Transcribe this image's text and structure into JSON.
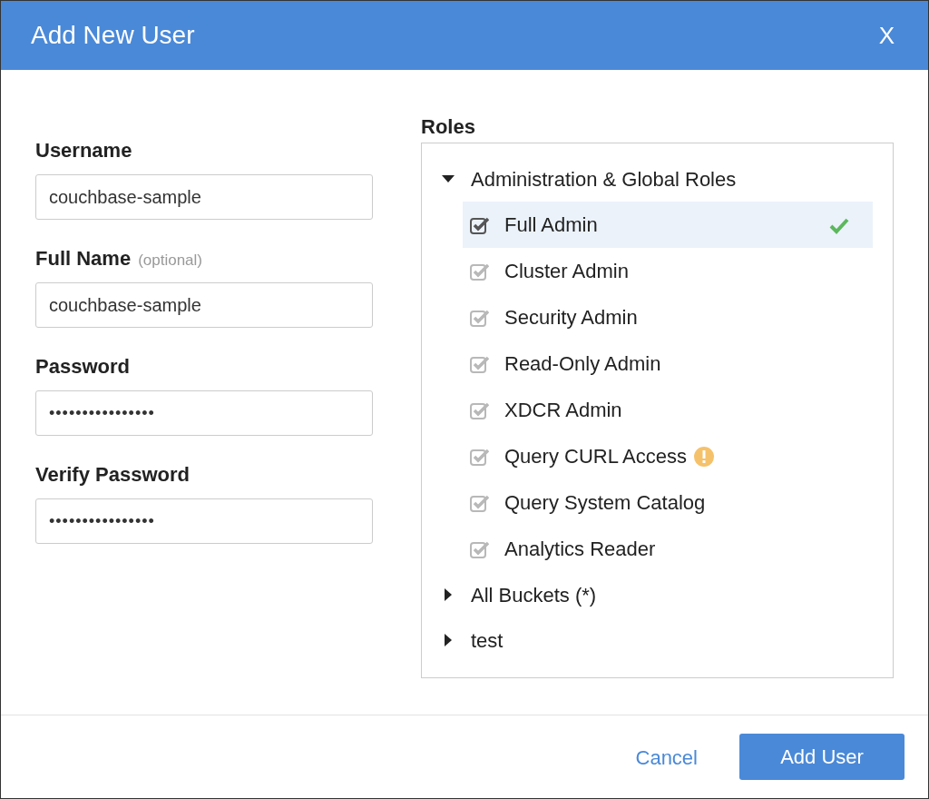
{
  "dialog": {
    "title": "Add New User",
    "close": "X"
  },
  "fields": [
    {
      "label": "Username",
      "kind": "text",
      "value": "couchbase-sample"
    },
    {
      "label": "Full Name",
      "hint": "(optional)",
      "kind": "text",
      "value": "couchbase-sample"
    },
    {
      "label": "Password",
      "kind": "password",
      "value": "••••••••••••••••"
    },
    {
      "label": "Verify Password",
      "kind": "password",
      "value": "••••••••••••••••"
    }
  ],
  "roles": {
    "title": "Roles",
    "groups": [
      {
        "label": "Administration & Global Roles",
        "expanded": true,
        "children": [
          {
            "label": "Full Admin",
            "checked": true,
            "disabled": false,
            "selected": true,
            "warning": false
          },
          {
            "label": "Cluster Admin",
            "checked": true,
            "disabled": true,
            "selected": false,
            "warning": false
          },
          {
            "label": "Security Admin",
            "checked": true,
            "disabled": true,
            "selected": false,
            "warning": false
          },
          {
            "label": "Read-Only Admin",
            "checked": true,
            "disabled": true,
            "selected": false,
            "warning": false
          },
          {
            "label": "XDCR Admin",
            "checked": true,
            "disabled": true,
            "selected": false,
            "warning": false
          },
          {
            "label": "Query CURL Access",
            "checked": true,
            "disabled": true,
            "selected": false,
            "warning": true
          },
          {
            "label": "Query System Catalog",
            "checked": true,
            "disabled": true,
            "selected": false,
            "warning": false
          },
          {
            "label": "Analytics Reader",
            "checked": true,
            "disabled": true,
            "selected": false,
            "warning": false
          }
        ]
      },
      {
        "label": "All Buckets (*)",
        "expanded": false
      },
      {
        "label": "test",
        "expanded": false
      }
    ]
  },
  "buttons": {
    "cancel": "Cancel",
    "submit": "Add User"
  }
}
